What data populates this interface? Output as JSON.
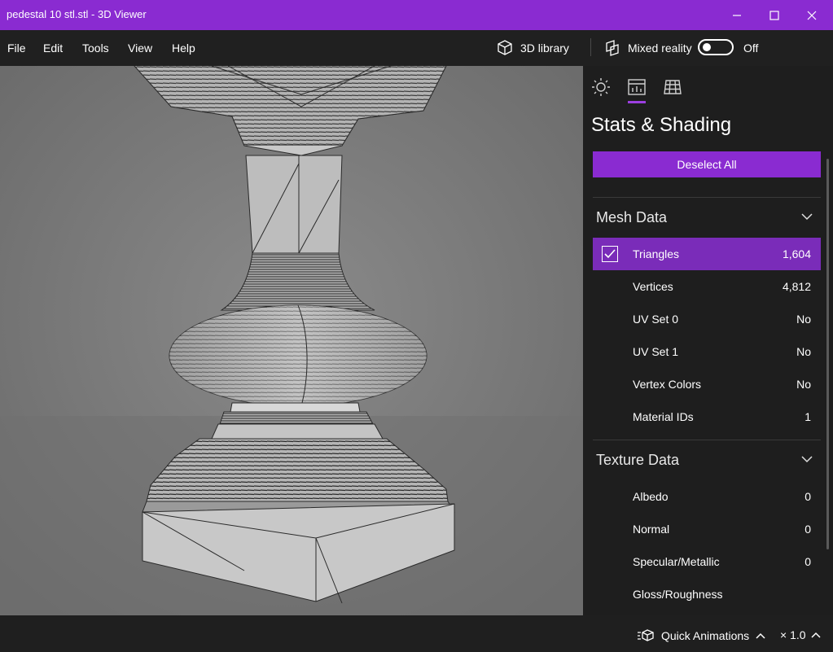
{
  "window": {
    "title": "pedestal 10 stl.stl - 3D Viewer",
    "accent": "#8a2bd1"
  },
  "menu": {
    "file": "File",
    "edit": "Edit",
    "tools": "Tools",
    "view": "View",
    "help": "Help",
    "library_label": "3D library",
    "mixed_reality_label": "Mixed reality",
    "mixed_reality_state": "Off"
  },
  "panel": {
    "tabs": [
      "lighting-icon",
      "stats-icon",
      "grid-icon"
    ],
    "active_tab": "stats-icon",
    "title": "Stats & Shading",
    "deselect_label": "Deselect All",
    "mesh_section": {
      "title": "Mesh Data",
      "rows": [
        {
          "name": "Triangles",
          "value": "1,604",
          "selected": true
        },
        {
          "name": "Vertices",
          "value": "4,812"
        },
        {
          "name": "UV Set 0",
          "value": "No"
        },
        {
          "name": "UV Set 1",
          "value": "No"
        },
        {
          "name": "Vertex Colors",
          "value": "No"
        },
        {
          "name": "Material IDs",
          "value": "1"
        }
      ]
    },
    "texture_section": {
      "title": "Texture Data",
      "rows": [
        {
          "name": "Albedo",
          "value": "0"
        },
        {
          "name": "Normal",
          "value": "0"
        },
        {
          "name": "Specular/Metallic",
          "value": "0"
        },
        {
          "name": "Gloss/Roughness",
          "value": ""
        }
      ]
    }
  },
  "status": {
    "quick_animations": "Quick Animations",
    "speed": "× 1.0"
  }
}
